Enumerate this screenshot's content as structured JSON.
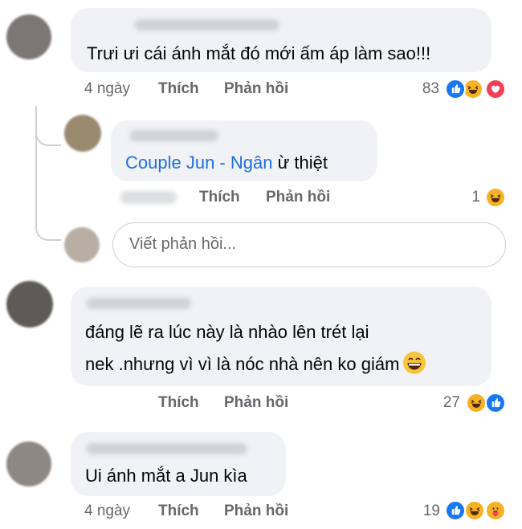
{
  "comments": [
    {
      "text": "Trưi ưi cái ánh mắt đó mới ấm áp làm sao!!!",
      "time": "4 ngày",
      "like_label": "Thích",
      "reply_label": "Phản hồi",
      "reaction_count": "83",
      "reactions": [
        "like-icon",
        "haha-icon",
        "love-icon"
      ]
    },
    {
      "mention": "Couple Jun - Ngân",
      "text": " ừ thiệt",
      "like_label": "Thích",
      "reply_label": "Phản hồi",
      "reaction_count": "1",
      "reactions": [
        "haha-icon"
      ]
    },
    {
      "line1": "đáng lẽ ra lúc này là nhào lên trét lại",
      "line2": "nek .nhưng vì vì là nóc nhà nên ko giám",
      "like_label": "Thích",
      "reply_label": "Phản hồi",
      "reaction_count": "27",
      "reactions": [
        "haha-icon",
        "like-icon"
      ]
    },
    {
      "text": "Ui ánh mắt a Jun kìa",
      "time": "4 ngày",
      "like_label": "Thích",
      "reply_label": "Phản hồi",
      "reaction_count": "19",
      "reactions": [
        "like-icon",
        "haha-icon",
        "care-icon"
      ]
    }
  ],
  "reply_input": {
    "placeholder": "Viết phản hồi..."
  },
  "colors": {
    "bubble": "#f0f2f5",
    "link": "#216fdb",
    "meta": "#65676b",
    "like": "#1877f2",
    "haha": "#f7b125",
    "love": "#f33e58"
  }
}
